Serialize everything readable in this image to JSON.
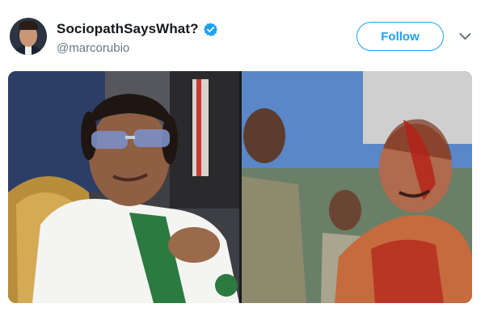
{
  "tweet": {
    "display_name": "SociopathSaysWhat?",
    "handle": "@marcorubio",
    "follow_label": "Follow",
    "verified": true
  },
  "colors": {
    "accent": "#1da1f2",
    "name_text": "#14171a",
    "secondary_text": "#657786"
  },
  "icons": {
    "verified": "verified-badge-icon",
    "menu": "chevron-down-icon"
  },
  "media": {
    "photos": [
      "left-photo",
      "right-photo"
    ]
  }
}
